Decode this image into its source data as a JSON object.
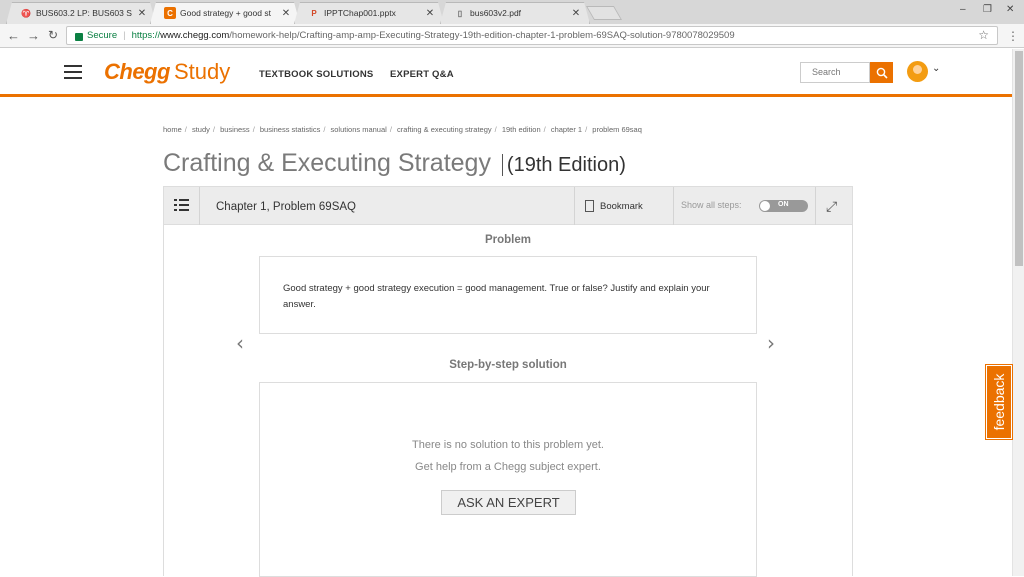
{
  "browser": {
    "tabs": [
      {
        "label": "BUS603.2 LP: BUS603 S",
        "icon": "app-icon"
      },
      {
        "label": "Good strategy + good st",
        "icon": "chegg-favicon",
        "active": true
      },
      {
        "label": "IPPTChap001.pptx",
        "icon": "powerpoint-icon"
      },
      {
        "label": "bus603v2.pdf",
        "icon": "document-icon"
      }
    ],
    "secure_label": "Secure",
    "url_scheme": "https://",
    "url_host": "www.chegg.com",
    "url_path": "/homework-help/Crafting-amp-amp-Executing-Strategy-19th-edition-chapter-1-problem-69SAQ-solution-9780078029509"
  },
  "header": {
    "logo_chegg": "Chegg",
    "logo_study": "Study",
    "nav": [
      "TEXTBOOK SOLUTIONS",
      "EXPERT Q&A"
    ],
    "search_placeholder": "Search",
    "brand_color": "#eb7100"
  },
  "breadcrumb": [
    "home",
    "study",
    "business",
    "business statistics",
    "solutions manual",
    "crafting & executing strategy",
    "19th edition",
    "chapter 1",
    "problem 69saq"
  ],
  "page": {
    "title": "Crafting & Executing Strategy",
    "edition": "(19th Edition)"
  },
  "panel": {
    "chapter_label": "Chapter 1, Problem 69SAQ",
    "bookmark_label": "Bookmark",
    "show_all_label": "Show all steps:",
    "toggle_label": "ON",
    "problem_heading": "Problem",
    "problem_text": "Good strategy + good strategy execution = good management. True or false? Justify and explain your answer.",
    "solution_heading": "Step-by-step solution",
    "no_solution_line1": "There is no solution to this problem yet.",
    "no_solution_line2": "Get help from a Chegg subject expert.",
    "ask_button": "ASK AN EXPERT"
  },
  "feedback_label": "feedback"
}
